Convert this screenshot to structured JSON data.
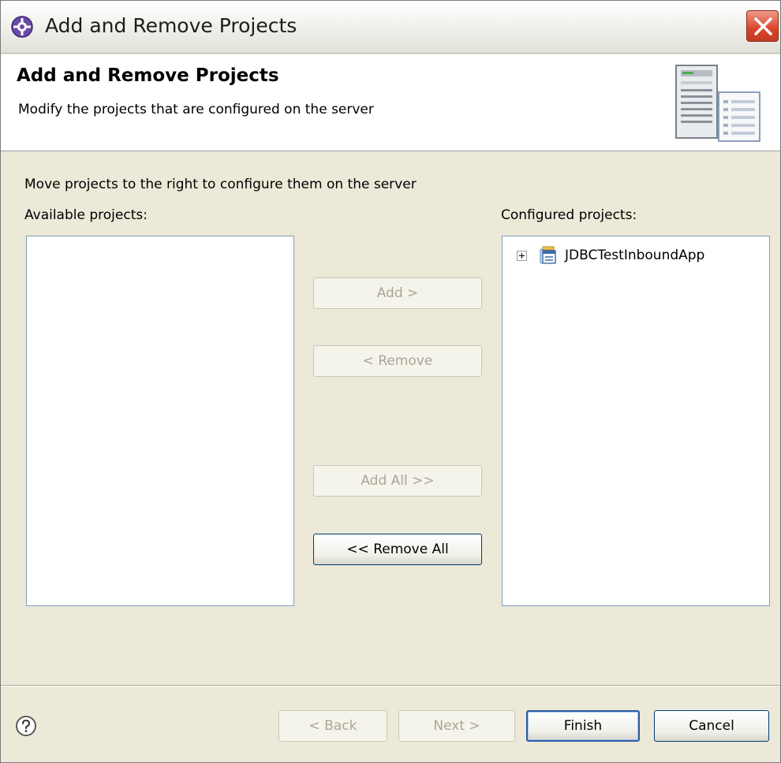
{
  "window": {
    "title": "Add and Remove Projects"
  },
  "header": {
    "title": "Add and Remove Projects",
    "description": "Modify the projects that are configured on the server"
  },
  "body": {
    "instruction": "Move projects to the right to configure them on the server",
    "available_label": "Available projects:",
    "configured_label": "Configured projects:",
    "available_projects": [],
    "configured_projects": [
      {
        "label": "JDBCTestInboundApp",
        "expandable": true,
        "icon": "enterprise-application-icon"
      }
    ]
  },
  "actions": {
    "add": {
      "label": "Add >",
      "enabled": false
    },
    "remove": {
      "label": "< Remove",
      "enabled": false
    },
    "add_all": {
      "label": "Add All >>",
      "enabled": false
    },
    "remove_all": {
      "label": "<< Remove All",
      "enabled": true
    }
  },
  "footer": {
    "back": {
      "label": "< Back",
      "enabled": false
    },
    "next": {
      "label": "Next >",
      "enabled": false
    },
    "finish": {
      "label": "Finish",
      "enabled": true,
      "default": true
    },
    "cancel": {
      "label": "Cancel",
      "enabled": true
    }
  },
  "icons": {
    "app": "eclipse-app-icon",
    "close": "close-icon",
    "wizard": "server-wizard-graphic",
    "help": "help-icon"
  },
  "colors": {
    "dialog_bg": "#ece9d8",
    "close_button": "#d9442b",
    "list_border": "#7f9db9",
    "default_button_border": "#2e5ba4"
  }
}
